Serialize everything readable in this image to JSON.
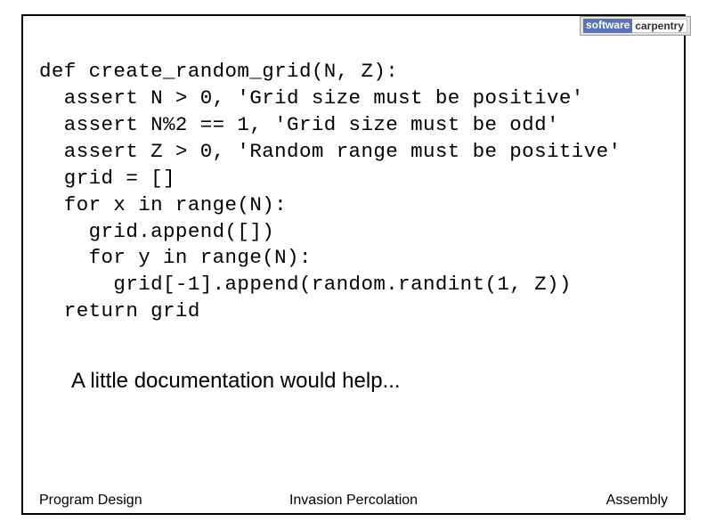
{
  "logo": {
    "tiny_top": "",
    "software": "software",
    "carpentry": "carpentry",
    "sub": ""
  },
  "code": {
    "line1": "def create_random_grid(N, Z):",
    "line2": "  assert N > 0, 'Grid size must be positive'",
    "line3": "  assert N%2 == 1, 'Grid size must be odd'",
    "line4": "  assert Z > 0, 'Random range must be positive'",
    "line5": "  grid = []",
    "line6": "  for x in range(N):",
    "line7": "    grid.append([])",
    "line8": "    for y in range(N):",
    "line9": "      grid[-1].append(random.randint(1, Z))",
    "line10": "  return grid"
  },
  "caption": "A little documentation would help...",
  "footer": {
    "left": "Program Design",
    "center": "Invasion Percolation",
    "right": "Assembly"
  }
}
